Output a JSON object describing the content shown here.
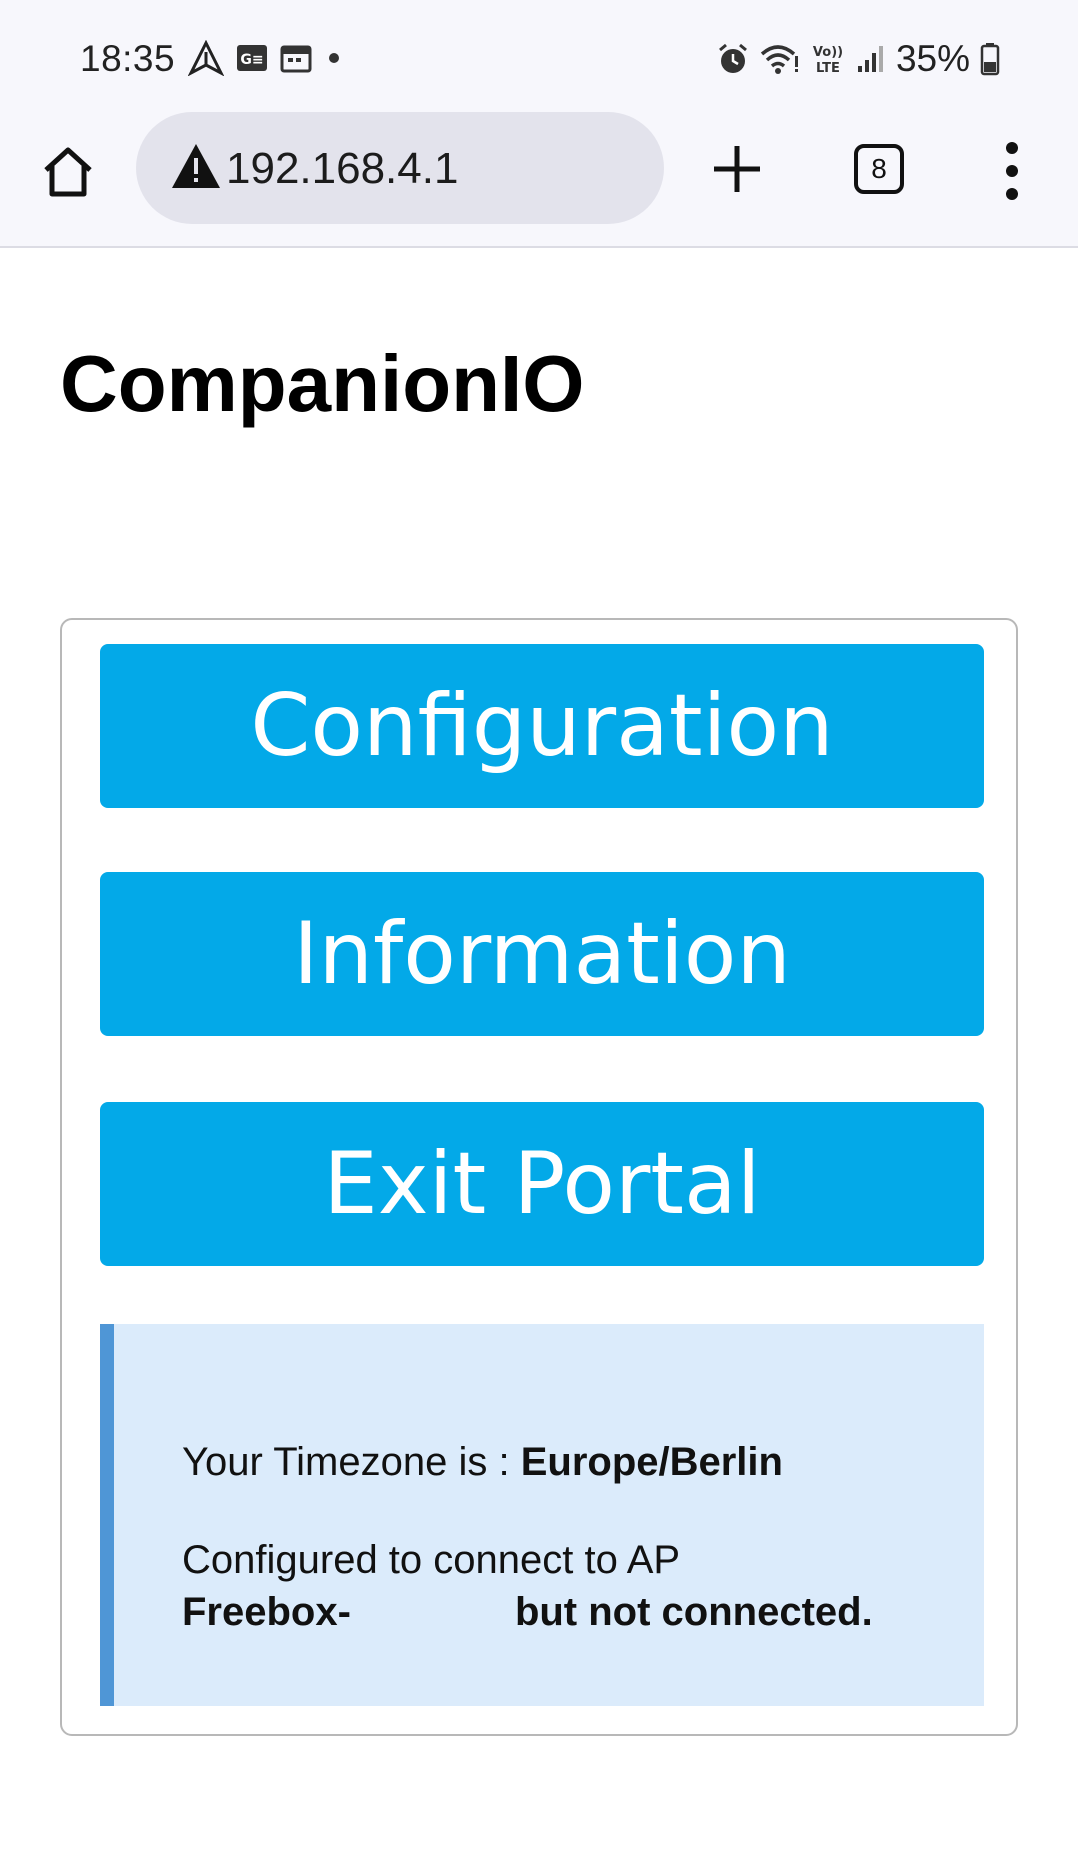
{
  "status_bar": {
    "time": "18:35",
    "battery": "35%",
    "left_icons": [
      "navigation-app-icon",
      "ge-notification-icon",
      "calendar-icon",
      "dot-icon"
    ],
    "right_icons": [
      "alarm-icon",
      "wifi-icon",
      "volte-icon",
      "signal-icon",
      "battery-icon"
    ],
    "volte_label": "Vo)) LTE"
  },
  "browser": {
    "url": "192.168.4.1",
    "tab_count": "8"
  },
  "page": {
    "title": "CompanionIO"
  },
  "menu": {
    "configuration": "Configuration",
    "information": "Information",
    "exit": "Exit Portal"
  },
  "info": {
    "timezone_label": "Your Timezone is : ",
    "timezone_value": "Europe/Berlin",
    "ap_label": "Configured to connect to AP",
    "ap_name": "Freebox-",
    "ap_status": "but not connected."
  },
  "colors": {
    "button_bg": "#03a9e8",
    "info_bg": "#dbebfb",
    "info_accent": "#4f96d6"
  }
}
